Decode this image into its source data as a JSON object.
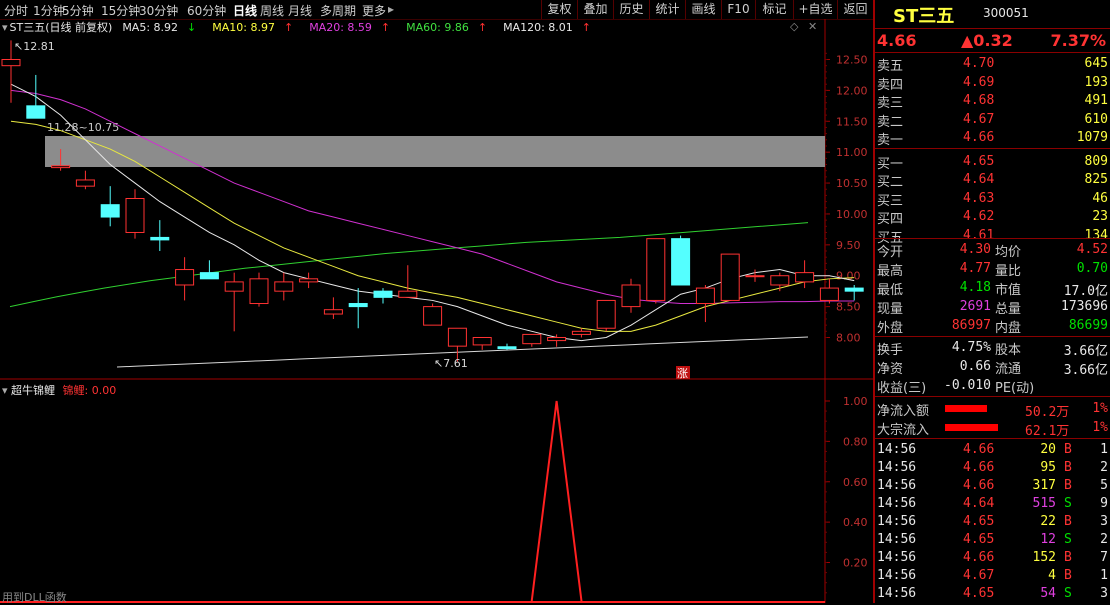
{
  "toolbar": {
    "periods": [
      "分时",
      "1分钟",
      "5分钟",
      "15分钟",
      "30分钟",
      "60分钟",
      "日线",
      "周线",
      "月线",
      "多周期",
      "更多"
    ],
    "active_period": "日线",
    "more_arrow": "▸",
    "right_buttons": [
      "复权",
      "叠加",
      "历史",
      "统计",
      "画线",
      "F10",
      "标记",
      "+自选",
      "返回"
    ]
  },
  "legend": {
    "title": "ST三五(日线 前复权)",
    "ma": [
      {
        "label": "MA5: 8.92",
        "arrow": "↓",
        "color": "#e8e8e8"
      },
      {
        "label": "MA10: 8.97",
        "arrow": "↑",
        "color": "#ffff40"
      },
      {
        "label": "MA20: 8.59",
        "arrow": "↑",
        "color": "#e040e0"
      },
      {
        "label": "MA60: 9.86",
        "arrow": "↑",
        "color": "#40e040"
      },
      {
        "label": "MA120: 8.01",
        "arrow": "↑",
        "color": "#e8e8e8"
      }
    ]
  },
  "annotations": {
    "high": "12.81",
    "low": "7.61",
    "band": "11.28~10.75",
    "today_mark": "涨"
  },
  "indicator": {
    "name": "超牛锦鲤",
    "series_label": "锦鲤: 0.00",
    "dll_note": "用到DLL函数",
    "color": "#ff2020"
  },
  "chart_data": [
    {
      "type": "candlestick",
      "title": "ST三五(日线 前复权)",
      "ylim": [
        7.7,
        12.7
      ],
      "y_ticks": [
        "12.50",
        "12.00",
        "11.50",
        "11.00",
        "10.50",
        "10.00",
        "9.50",
        "9.00",
        "8.50",
        "8.00"
      ],
      "candles": [
        {
          "o": 12.4,
          "h": 12.81,
          "l": 11.8,
          "c": 12.5
        },
        {
          "o": 11.75,
          "h": 12.25,
          "l": 11.55,
          "c": 11.55
        },
        {
          "o": 10.75,
          "h": 11.05,
          "l": 10.7,
          "c": 10.78
        },
        {
          "o": 10.45,
          "h": 10.7,
          "l": 10.4,
          "c": 10.55
        },
        {
          "o": 10.15,
          "h": 10.45,
          "l": 9.8,
          "c": 9.95
        },
        {
          "o": 9.7,
          "h": 10.4,
          "l": 9.6,
          "c": 10.25
        },
        {
          "o": 9.62,
          "h": 9.9,
          "l": 9.4,
          "c": 9.58
        },
        {
          "o": 8.85,
          "h": 9.3,
          "l": 8.6,
          "c": 9.1
        },
        {
          "o": 9.05,
          "h": 9.25,
          "l": 8.95,
          "c": 8.95
        },
        {
          "o": 8.75,
          "h": 9.05,
          "l": 8.1,
          "c": 8.9
        },
        {
          "o": 8.55,
          "h": 9.05,
          "l": 8.5,
          "c": 8.95
        },
        {
          "o": 8.75,
          "h": 9.05,
          "l": 8.6,
          "c": 8.9
        },
        {
          "o": 8.9,
          "h": 9.05,
          "l": 8.8,
          "c": 8.95
        },
        {
          "o": 8.38,
          "h": 8.65,
          "l": 8.3,
          "c": 8.45
        },
        {
          "o": 8.55,
          "h": 8.8,
          "l": 8.15,
          "c": 8.5
        },
        {
          "o": 8.75,
          "h": 8.8,
          "l": 8.55,
          "c": 8.65
        },
        {
          "o": 8.65,
          "h": 9.17,
          "l": 8.65,
          "c": 8.75
        },
        {
          "o": 8.2,
          "h": 8.55,
          "l": 8.2,
          "c": 8.5
        },
        {
          "o": 7.86,
          "h": 8.1,
          "l": 7.61,
          "c": 8.15
        },
        {
          "o": 7.88,
          "h": 8.0,
          "l": 7.8,
          "c": 8.0
        },
        {
          "o": 7.85,
          "h": 7.9,
          "l": 7.8,
          "c": 7.82
        },
        {
          "o": 7.9,
          "h": 8.05,
          "l": 7.85,
          "c": 8.05
        },
        {
          "o": 7.95,
          "h": 8.05,
          "l": 7.85,
          "c": 8.0
        },
        {
          "o": 8.05,
          "h": 8.15,
          "l": 8.0,
          "c": 8.1
        },
        {
          "o": 8.15,
          "h": 8.6,
          "l": 8.1,
          "c": 8.6
        },
        {
          "o": 8.5,
          "h": 8.95,
          "l": 8.4,
          "c": 8.85
        },
        {
          "o": 8.6,
          "h": 9.6,
          "l": 8.55,
          "c": 9.6
        },
        {
          "o": 9.6,
          "h": 9.65,
          "l": 8.85,
          "c": 8.85
        },
        {
          "o": 8.55,
          "h": 8.85,
          "l": 8.25,
          "c": 8.8
        },
        {
          "o": 8.6,
          "h": 9.35,
          "l": 8.6,
          "c": 9.35
        },
        {
          "o": 9.0,
          "h": 9.1,
          "l": 8.9,
          "c": 9.0
        },
        {
          "o": 8.85,
          "h": 9.05,
          "l": 8.75,
          "c": 9.0
        },
        {
          "o": 8.9,
          "h": 9.25,
          "l": 8.8,
          "c": 9.05
        },
        {
          "o": 8.6,
          "h": 8.95,
          "l": 8.55,
          "c": 8.8
        },
        {
          "o": 8.8,
          "h": 8.85,
          "l": 8.6,
          "c": 8.75
        }
      ],
      "ma5": [
        12.1,
        11.9,
        11.6,
        11.2,
        10.8,
        10.5,
        10.2,
        9.95,
        9.7,
        9.5,
        9.25,
        9.05,
        8.95,
        8.85,
        8.75,
        8.7,
        8.65,
        8.6,
        8.5,
        8.35,
        8.2,
        8.1,
        8.0,
        7.95,
        8.0,
        8.2,
        8.45,
        8.7,
        8.8,
        8.95,
        9.05,
        9.1,
        9.0,
        9.0,
        8.92
      ],
      "ma10": [
        11.5,
        11.45,
        11.35,
        11.2,
        11.05,
        10.85,
        10.6,
        10.35,
        10.1,
        9.85,
        9.65,
        9.45,
        9.3,
        9.15,
        9.0,
        8.9,
        8.8,
        8.72,
        8.65,
        8.55,
        8.45,
        8.35,
        8.25,
        8.15,
        8.1,
        8.1,
        8.2,
        8.35,
        8.5,
        8.6,
        8.7,
        8.8,
        8.9,
        8.95,
        8.97
      ],
      "ma20": [
        12.0,
        11.95,
        11.85,
        11.7,
        11.5,
        11.3,
        11.1,
        10.9,
        10.7,
        10.5,
        10.35,
        10.2,
        10.05,
        9.95,
        9.85,
        9.75,
        9.65,
        9.55,
        9.45,
        9.35,
        9.2,
        9.05,
        8.9,
        8.8,
        8.7,
        8.62,
        8.58,
        8.55,
        8.55,
        8.56,
        8.57,
        8.58,
        8.58,
        8.59,
        8.59
      ],
      "ma60": [
        8.5,
        8.58,
        8.66,
        8.73,
        8.8,
        8.86,
        8.92,
        8.97,
        9.02,
        9.07,
        9.12,
        9.16,
        9.2,
        9.24,
        9.28,
        9.32,
        9.36,
        9.39,
        9.42,
        9.45,
        9.48,
        9.51,
        9.54,
        9.56,
        9.58,
        9.6,
        9.62,
        9.65,
        9.68,
        9.71,
        9.74,
        9.77,
        9.8,
        9.83,
        9.86
      ],
      "ma120": [
        7.78,
        7.79,
        7.8,
        7.81,
        7.82,
        7.83,
        7.84,
        7.85,
        7.86,
        7.87,
        7.88,
        7.88,
        7.89,
        7.9,
        7.9,
        7.91,
        7.92,
        7.92,
        7.93,
        7.93,
        7.94,
        7.95,
        7.95,
        7.96,
        7.96,
        7.97,
        7.97,
        7.98,
        7.98,
        7.99,
        7.99,
        8.0,
        8.0,
        8.01,
        8.01
      ]
    },
    {
      "type": "line",
      "title": "超牛锦鲤",
      "ylim": [
        0,
        1.05
      ],
      "y_ticks": [
        "1.00",
        "0.80",
        "0.60",
        "0.40",
        "0.20"
      ],
      "values": [
        0,
        0,
        0,
        0,
        0,
        0,
        0,
        0,
        0,
        0,
        0,
        0,
        0,
        0,
        0,
        0,
        0,
        0,
        0,
        0,
        0,
        0,
        1,
        0,
        0,
        0,
        0,
        0,
        0,
        0,
        0,
        0,
        0,
        0,
        0
      ]
    }
  ],
  "quote": {
    "name": "ST三五",
    "code": "300051",
    "price": "4.66",
    "change": "▲0.32",
    "pct": "7.37%",
    "asks": [
      {
        "label": "卖五",
        "price": "4.70",
        "vol": "645"
      },
      {
        "label": "卖四",
        "price": "4.69",
        "vol": "193"
      },
      {
        "label": "卖三",
        "price": "4.68",
        "vol": "491"
      },
      {
        "label": "卖二",
        "price": "4.67",
        "vol": "610"
      },
      {
        "label": "卖一",
        "price": "4.66",
        "vol": "1079"
      }
    ],
    "bids": [
      {
        "label": "买一",
        "price": "4.65",
        "vol": "809"
      },
      {
        "label": "买二",
        "price": "4.64",
        "vol": "825"
      },
      {
        "label": "买三",
        "price": "4.63",
        "vol": "46"
      },
      {
        "label": "买四",
        "price": "4.62",
        "vol": "23"
      },
      {
        "label": "买五",
        "price": "4.61",
        "vol": "134"
      }
    ],
    "stats": [
      {
        "l1": "今开",
        "v1": "4.30",
        "c1": "red",
        "l2": "均价",
        "v2": "4.52",
        "c2": "red"
      },
      {
        "l1": "最高",
        "v1": "4.77",
        "c1": "red",
        "l2": "量比",
        "v2": "0.70",
        "c2": "green"
      },
      {
        "l1": "最低",
        "v1": "4.18",
        "c1": "green",
        "l2": "市值",
        "v2": "17.0亿",
        "c2": "white"
      },
      {
        "l1": "现量",
        "v1": "2691",
        "c1": "magenta",
        "l2": "总量",
        "v2": "173696",
        "c2": "white"
      },
      {
        "l1": "外盘",
        "v1": "86997",
        "c1": "red",
        "l2": "内盘",
        "v2": "86699",
        "c2": "green"
      }
    ],
    "stats2": [
      {
        "l1": "换手",
        "v1": "4.75%",
        "l2": "股本",
        "v2": "3.66亿"
      },
      {
        "l1": "净资",
        "v1": "0.66",
        "l2": "流通",
        "v2": "3.66亿"
      },
      {
        "l1": "收益(三)",
        "v1": "-0.010",
        "l2": "PE(动)",
        "v2": ""
      }
    ],
    "flows": [
      {
        "label": "净流入额",
        "amount": "50.2万",
        "pct": "1%",
        "bar": 0.6
      },
      {
        "label": "大宗流入",
        "amount": "62.1万",
        "pct": "1%",
        "bar": 0.76
      }
    ],
    "ticks": [
      {
        "t": "14:56",
        "p": "4.66",
        "v": "20",
        "s": "B",
        "n": "1"
      },
      {
        "t": "14:56",
        "p": "4.66",
        "v": "95",
        "s": "B",
        "n": "2"
      },
      {
        "t": "14:56",
        "p": "4.66",
        "v": "317",
        "s": "B",
        "n": "5"
      },
      {
        "t": "14:56",
        "p": "4.64",
        "v": "515",
        "s": "S",
        "n": "9"
      },
      {
        "t": "14:56",
        "p": "4.65",
        "v": "22",
        "s": "B",
        "n": "3"
      },
      {
        "t": "14:56",
        "p": "4.65",
        "v": "12",
        "s": "S",
        "n": "2"
      },
      {
        "t": "14:56",
        "p": "4.66",
        "v": "152",
        "s": "B",
        "n": "7"
      },
      {
        "t": "14:56",
        "p": "4.67",
        "v": "4",
        "s": "B",
        "n": "1"
      },
      {
        "t": "14:56",
        "p": "4.65",
        "v": "54",
        "s": "S",
        "n": "3"
      }
    ]
  }
}
